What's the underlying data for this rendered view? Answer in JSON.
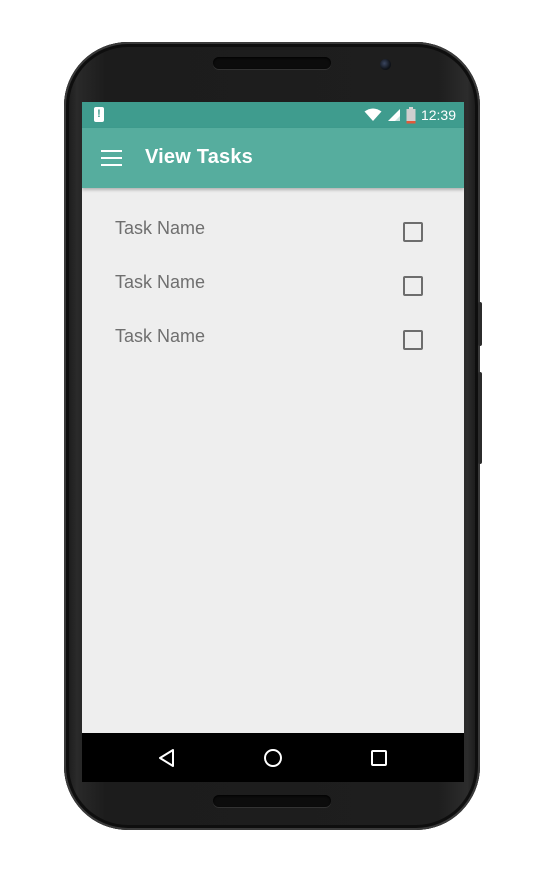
{
  "status_bar": {
    "time": "12:39",
    "alert_icon": "battery-alert-icon",
    "icons": [
      "wifi-icon",
      "signal-icon",
      "battery-icon"
    ]
  },
  "app_bar": {
    "title": "View Tasks",
    "menu_icon": "hamburger-menu-icon"
  },
  "tasks": [
    {
      "name": "Task Name",
      "checked": false
    },
    {
      "name": "Task Name",
      "checked": false
    },
    {
      "name": "Task Name",
      "checked": false
    }
  ],
  "nav_bar": {
    "buttons": [
      "back-icon",
      "home-icon",
      "recents-icon"
    ]
  },
  "colors": {
    "status_bar": "#3f9c8e",
    "app_bar": "#56ad9e",
    "background": "#eeeeee"
  }
}
